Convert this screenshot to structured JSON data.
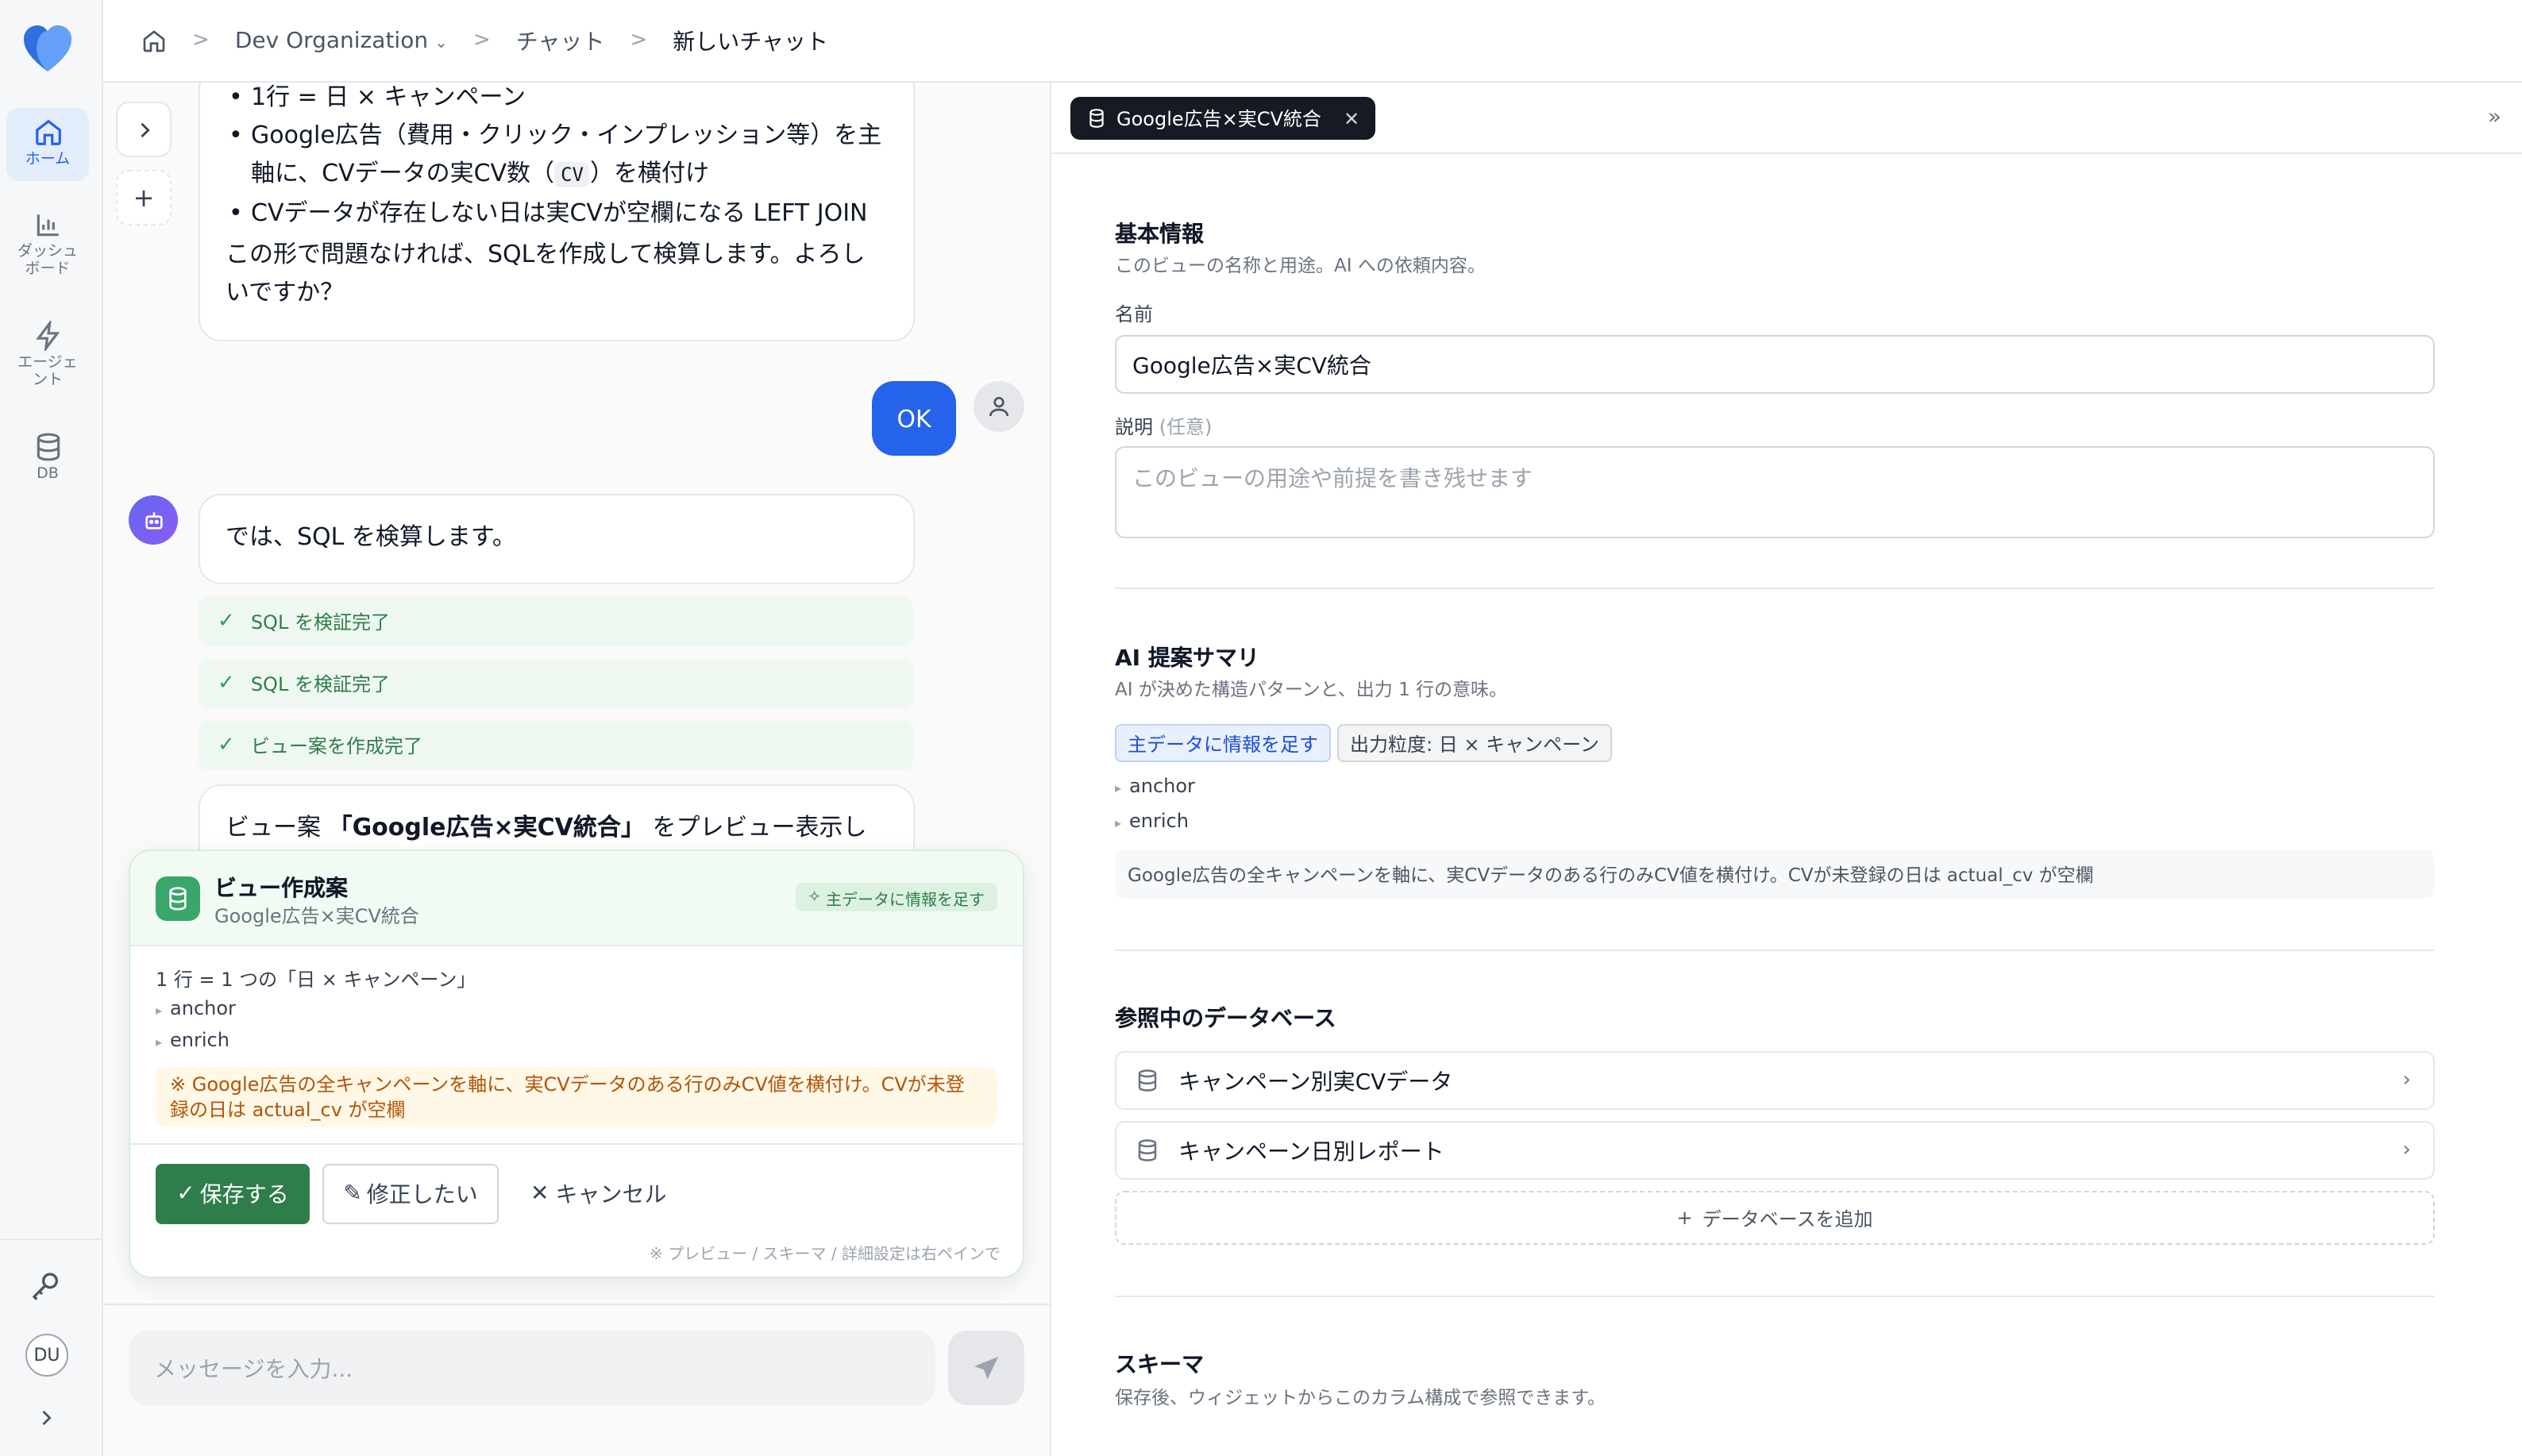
{
  "breadcrumb": {
    "org": "Dev Organization",
    "section": "チャット",
    "current": "新しいチャット"
  },
  "rail": {
    "items": [
      {
        "label": "ホーム",
        "icon": "home-icon",
        "active": true
      },
      {
        "label": "ダッシュボード",
        "icon": "bar-chart-icon"
      },
      {
        "label": "エージェント",
        "icon": "lightning-icon"
      },
      {
        "label": "DB",
        "icon": "database-icon"
      }
    ],
    "user_initials": "DU"
  },
  "chat": {
    "ai_message_1": {
      "bullets": [
        "1行 = 日 × キャンペーン",
        "Google広告（費用・クリック・インプレッション等）を主軸に、CVデータの実CV数（",
        "CVデータが存在しない日は実CVが空欄になる LEFT JOIN"
      ],
      "bullet2_code": "CV",
      "bullet2_tail": "）を横付け",
      "closing": "この形で問題なければ、SQLを作成して検算します。よろしいですか？"
    },
    "user_message": "OK",
    "ai_message_2": "では、SQL を検算します。",
    "steps": [
      "SQL を検証完了",
      "SQL を検証完了",
      "ビュー案を作成完了"
    ],
    "ai_message_3": {
      "prefix": "ビュー案 ",
      "bold": "「Google広告×実CV統合」",
      "suffix": " をプレビュー表示しまし"
    },
    "proposal": {
      "title": "ビュー作成案",
      "subtitle": "Google広告×実CV統合",
      "badge": "主データに情報を足す",
      "grain": "1 行 = 1 つの「日 × キャンペーン」",
      "kinds": [
        "anchor",
        "enrich"
      ],
      "note": "※ Google広告の全キャンペーンを軸に、実CVデータのある行のみCV値を横付け。CVが未登録の日は actual_cv が空欄",
      "save": "保存する",
      "edit": "修正したい",
      "cancel": "キャンセル",
      "footer": "※ プレビュー / スキーマ / 詳細設定は右ペインで"
    },
    "composer_placeholder": "メッセージを入力..."
  },
  "panel": {
    "tab_label": "Google広告×実CV統合",
    "basic": {
      "title": "基本情報",
      "subtitle": "このビューの名称と用途。AI への依頼内容。",
      "name_label": "名前",
      "name_value": "Google広告×実CV統合",
      "desc_label": "説明",
      "desc_optional": "(任意)",
      "desc_placeholder": "このビューの用途や前提を書き残せます"
    },
    "ai_summary": {
      "title": "AI 提案サマリ",
      "subtitle": "AI が決めた構造パターンと、出力 1 行の意味。",
      "chip_pattern": "主データに情報を足す",
      "chip_grain": "出力粒度: 日 × キャンペーン",
      "kinds": [
        "anchor",
        "enrich"
      ],
      "summary": "Google広告の全キャンペーンを軸に、実CVデータのある行のみCV値を横付け。CVが未登録の日は actual_cv が空欄"
    },
    "databases": {
      "title": "参照中のデータベース",
      "items": [
        "キャンペーン別実CVデータ",
        "キャンペーン日別レポート"
      ],
      "add_label": "データベースを追加"
    },
    "schema": {
      "title": "スキーマ",
      "subtitle": "保存後、ウィジェットからこのカラム構成で参照できます。"
    }
  },
  "colors": {
    "accent": "#2563eb",
    "success": "#2f7d4a",
    "tab_dark": "#151a23"
  }
}
